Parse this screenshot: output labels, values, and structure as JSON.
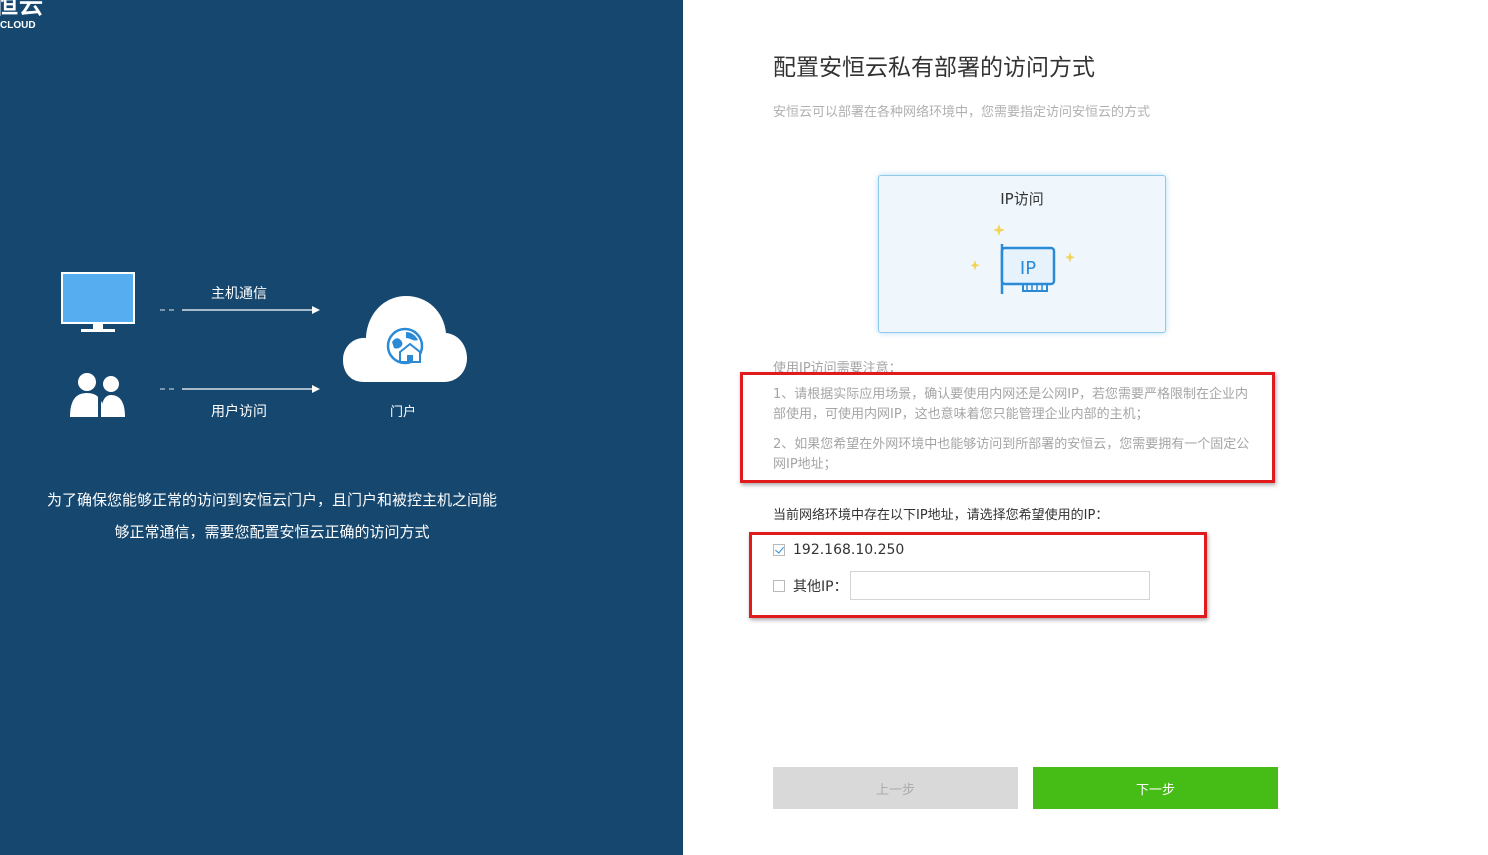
{
  "brand": {
    "logo_glyph": "恒云",
    "logo_sub": "CLOUD"
  },
  "diagram": {
    "host_label": "主机通信",
    "user_label": "用户访问",
    "portal_label": "门户",
    "description": "为了确保您能够正常的访问到安恒云门户，且门户和被控主机之间能够正常通信，需要您配置安恒云正确的访问方式"
  },
  "page": {
    "title": "配置安恒云私有部署的访问方式",
    "subtitle": "安恒云可以部署在各种网络环境中，您需要指定访问安恒云的方式"
  },
  "access_card": {
    "title": "IP访问",
    "icon_text": "IP",
    "icon": "ip-card-icon"
  },
  "notes": {
    "heading": "使用IP访问需要注意：",
    "items": [
      "1、请根据实际应用场景，确认要使用内网还是公网IP，若您需要严格限制在企业内部使用，可使用内网IP，这也意味着您只能管理企业内部的主机；",
      "2、如果您希望在外网环境中也能够访问到所部署的安恒云，您需要拥有一个固定公网IP地址；"
    ]
  },
  "ip_select": {
    "prompt": "当前网络环境中存在以下IP地址，请选择您希望使用的IP：",
    "options": [
      {
        "label": "192.168.10.250",
        "checked": true
      },
      {
        "label": "其他IP：",
        "checked": false,
        "input_value": ""
      }
    ]
  },
  "buttons": {
    "prev": "上一步",
    "next": "下一步"
  },
  "colors": {
    "left_panel_bg": "#16476f",
    "accent_blue": "#2b8ad6",
    "next_button": "#46bd17",
    "highlight_red": "#e01b1b"
  }
}
